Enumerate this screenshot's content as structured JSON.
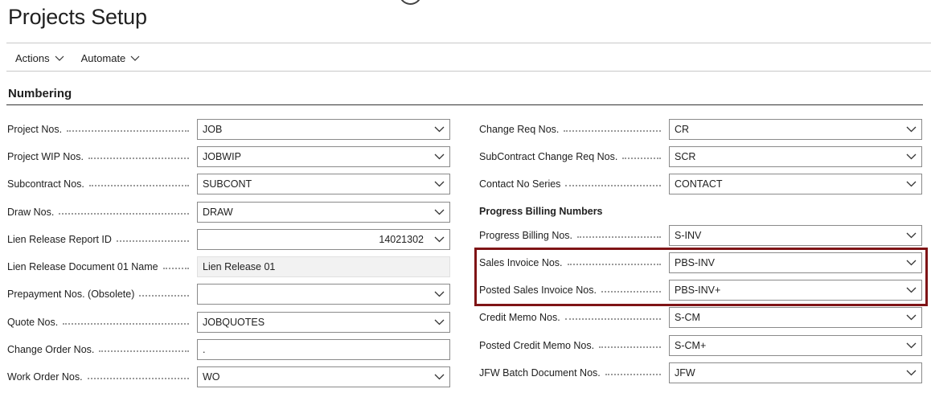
{
  "page": {
    "title": "Projects Setup"
  },
  "actionbar": {
    "actions_label": "Actions",
    "automate_label": "Automate"
  },
  "section": {
    "title": "Numbering"
  },
  "left_fields": [
    {
      "label": "Project Nos.",
      "value": "JOB",
      "type": "select"
    },
    {
      "label": "Project WIP Nos.",
      "value": "JOBWIP",
      "type": "select"
    },
    {
      "label": "Subcontract Nos.",
      "value": "SUBCONT",
      "type": "select"
    },
    {
      "label": "Draw Nos.",
      "value": "DRAW",
      "type": "select"
    },
    {
      "label": "Lien Release Report ID",
      "value": "14021302",
      "type": "number-select"
    },
    {
      "label": "Lien Release Document 01 Name",
      "value": "Lien Release 01",
      "type": "readonly"
    },
    {
      "label": "Prepayment Nos. (Obsolete)",
      "value": "",
      "type": "select"
    },
    {
      "label": "Quote Nos.",
      "value": "JOBQUOTES",
      "type": "select"
    },
    {
      "label": "Change Order Nos.",
      "value": ".",
      "type": "text"
    },
    {
      "label": "Work Order Nos.",
      "value": "WO",
      "type": "select"
    }
  ],
  "right_fields_top": [
    {
      "label": "Change Req Nos.",
      "value": "CR",
      "type": "select"
    },
    {
      "label": "SubContract Change Req Nos.",
      "value": "SCR",
      "type": "select"
    },
    {
      "label": "Contact No Series",
      "value": "CONTACT",
      "type": "select"
    }
  ],
  "progress_billing": {
    "heading": "Progress Billing Numbers"
  },
  "right_fields_bottom": [
    {
      "label": "Progress Billing Nos.",
      "value": "S-INV",
      "type": "select"
    },
    {
      "label": "Sales Invoice Nos.",
      "value": "PBS-INV",
      "type": "select"
    },
    {
      "label": "Posted Sales Invoice Nos.",
      "value": "PBS-INV+",
      "type": "select"
    },
    {
      "label": "Credit Memo Nos.",
      "value": "S-CM",
      "type": "select"
    },
    {
      "label": "Posted Credit Memo Nos.",
      "value": "S-CM+",
      "type": "select"
    },
    {
      "label": "JFW Batch Document Nos.",
      "value": "JFW",
      "type": "select"
    }
  ],
  "colors": {
    "highlight": "#7f1416",
    "text": "#212121",
    "border": "#8a8a8a"
  },
  "icons": {
    "dropdown": "chevron-down-icon",
    "top": "circle-icon"
  }
}
